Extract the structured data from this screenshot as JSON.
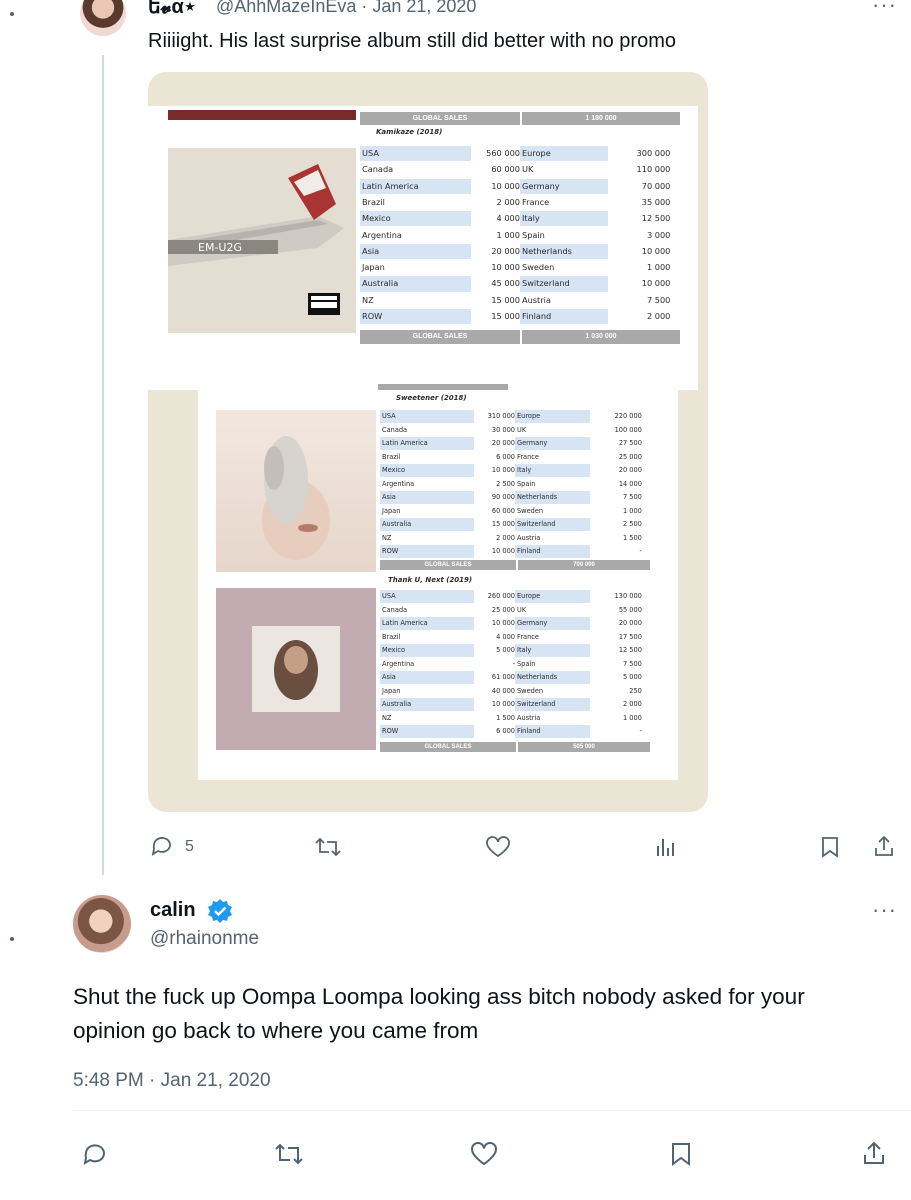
{
  "tweet1": {
    "display_name": "ե𝓿α⋆",
    "handle_date": "@AhhMazeInEva · Jan 21, 2020",
    "text": "Riiiight. His last surprise album still did better with no promo",
    "menu_label": "···",
    "replies": "5"
  },
  "sales_tables": {
    "header_label": "GLOBAL SALES",
    "kamikaze": {
      "title": "Kamikaze (2018)",
      "top_total": "1 180 000",
      "bottom_total": "1 030 000",
      "rows": [
        [
          "USA",
          "560 000",
          "Europe",
          "300 000"
        ],
        [
          "Canada",
          "60 000",
          "UK",
          "110 000"
        ],
        [
          "Latin America",
          "10 000",
          "Germany",
          "70 000"
        ],
        [
          "Brazil",
          "2 000",
          "France",
          "35 000"
        ],
        [
          "Mexico",
          "4 000",
          "Italy",
          "12 500"
        ],
        [
          "Argentina",
          "1 000",
          "Spain",
          "3 000"
        ],
        [
          "Asia",
          "20 000",
          "Netherlands",
          "10 000"
        ],
        [
          "Japan",
          "10 000",
          "Sweden",
          "1 000"
        ],
        [
          "Australia",
          "45 000",
          "Switzerland",
          "10 000"
        ],
        [
          "NZ",
          "15 000",
          "Austria",
          "7 500"
        ],
        [
          "ROW",
          "15 000",
          "Finland",
          "2 000"
        ]
      ]
    },
    "sweetener": {
      "title": "Sweetener (2018)",
      "total": "700 000",
      "rows": [
        [
          "USA",
          "310 000",
          "Europe",
          "220 000"
        ],
        [
          "Canada",
          "30 000",
          "UK",
          "100 000"
        ],
        [
          "Latin America",
          "20 000",
          "Germany",
          "27 500"
        ],
        [
          "Brazil",
          "6 000",
          "France",
          "25 000"
        ],
        [
          "Mexico",
          "10 000",
          "Italy",
          "20 000"
        ],
        [
          "Argentina",
          "2 500",
          "Spain",
          "14 000"
        ],
        [
          "Asia",
          "90 000",
          "Netherlands",
          "7 500"
        ],
        [
          "Japan",
          "60 000",
          "Sweden",
          "1 000"
        ],
        [
          "Australia",
          "15 000",
          "Switzerland",
          "2 500"
        ],
        [
          "NZ",
          "2 000",
          "Austria",
          "1 500"
        ],
        [
          "ROW",
          "10 000",
          "Finland",
          "-"
        ]
      ]
    },
    "thank_u_next": {
      "title": "Thank U, Next (2019)",
      "total": "505 000",
      "rows": [
        [
          "USA",
          "260 000",
          "Europe",
          "130 000"
        ],
        [
          "Canada",
          "25 000",
          "UK",
          "55 000"
        ],
        [
          "Latin America",
          "10 000",
          "Germany",
          "20 000"
        ],
        [
          "Brazil",
          "4 000",
          "France",
          "17 500"
        ],
        [
          "Mexico",
          "5 000",
          "Italy",
          "12 500"
        ],
        [
          "Argentina",
          "-",
          "Spain",
          "7 500"
        ],
        [
          "Asia",
          "61 000",
          "Netherlands",
          "5 000"
        ],
        [
          "Japan",
          "40 000",
          "Sweden",
          "250"
        ],
        [
          "Australia",
          "10 000",
          "Switzerland",
          "2 000"
        ],
        [
          "NZ",
          "1 500",
          "Austria",
          "1 000"
        ],
        [
          "ROW",
          "6 000",
          "Finland",
          "-"
        ]
      ]
    },
    "plane_text": "EM-U2G",
    "advisory_label": "PARENTAL ADVISORY EXPLICIT CONTENT"
  },
  "tweet2": {
    "display_name": "calin",
    "handle": "@rhainonme",
    "text": "Shut the fuck up Oompa Loompa looking ass bitch nobody asked for your opinion go back to where you came from",
    "timestamp": "5:48 PM · Jan 21, 2020",
    "menu_label": "···"
  },
  "colors": {
    "verified_blue": "#1d9bf0",
    "muted_text": "#536471",
    "table_label_blue": "#d6e4f3",
    "table_header_gray": "#a9a9a9",
    "media_frame": "#ebe5d6"
  }
}
